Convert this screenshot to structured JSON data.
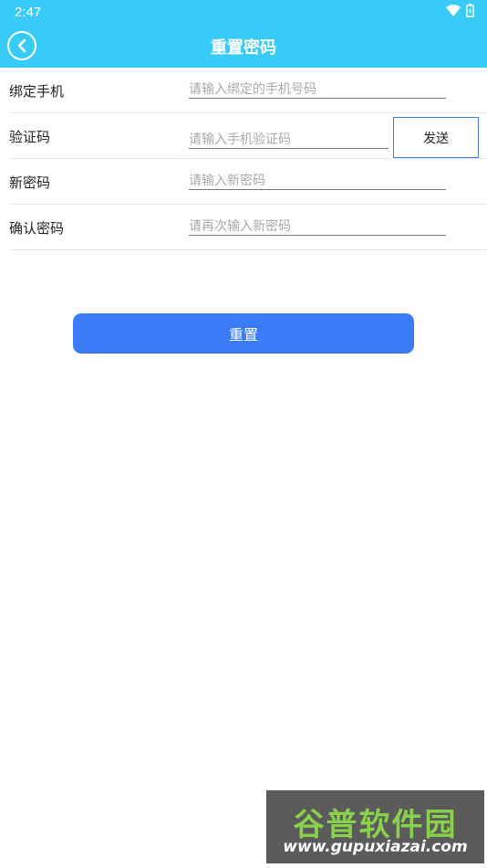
{
  "status_bar": {
    "time": "2:47"
  },
  "header": {
    "title": "重置密码"
  },
  "form": {
    "rows": [
      {
        "label": "绑定手机",
        "placeholder": "请输入绑定的手机号码"
      },
      {
        "label": "验证码",
        "placeholder": "请输入手机验证码",
        "send_label": "发送"
      },
      {
        "label": "新密码",
        "placeholder": "请输入新密码"
      },
      {
        "label": "确认密码",
        "placeholder": "请再次输入新密码"
      }
    ]
  },
  "submit_label": "重置",
  "watermark": {
    "title": "谷普软件园",
    "url": "www.gupuxiazai.com"
  },
  "colors": {
    "header": "#37cbf8",
    "primary_button": "#3b7cf6",
    "send_border": "#3f7ae6"
  }
}
